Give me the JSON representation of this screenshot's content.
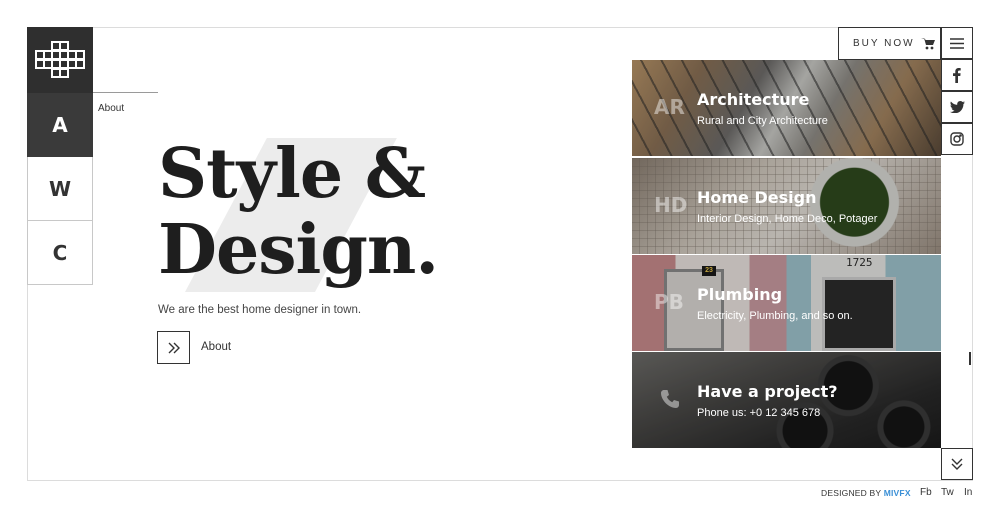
{
  "brand": {
    "logo_icon": "cross-grid-logo"
  },
  "left_nav": {
    "items": [
      {
        "letter": "A",
        "active": true
      },
      {
        "letter": "W",
        "active": false
      },
      {
        "letter": "C",
        "active": false
      }
    ],
    "active_label": "About"
  },
  "hero": {
    "title_line1": "Style &",
    "title_line2": "Design.",
    "subtitle": "We are the best home designer in town.",
    "button_icon": "double-chevron-right-icon",
    "button_label": "About"
  },
  "header": {
    "buy_now_label": "BUY NOW",
    "cart_icon": "cart-icon"
  },
  "social_sidebar": [
    "menu-icon",
    "facebook-icon",
    "twitter-icon",
    "instagram-icon"
  ],
  "services": [
    {
      "abbr": "AR",
      "title": "Architecture",
      "desc": "Rural and City Architecture"
    },
    {
      "abbr": "HD",
      "title": "Home Design",
      "desc": "Interior Design, Home Deco, Potager"
    },
    {
      "abbr": "PB",
      "title": "Plumbing",
      "desc": "Electricity, Plumbing, and so on.",
      "sign_number": "1725",
      "sign_small": "23"
    },
    {
      "icon": "phone-icon",
      "title": "Have a project?",
      "desc": "Phone us: +0 12 345 678"
    }
  ],
  "footer": {
    "designed_by": "DESIGNED BY",
    "designer": "MIVFX",
    "links": [
      "Fb",
      "Tw",
      "In"
    ]
  },
  "colors": {
    "dark": "#2f2f2f",
    "accent_link": "#3a8fd6",
    "frame_border": "#dcdcdc"
  }
}
